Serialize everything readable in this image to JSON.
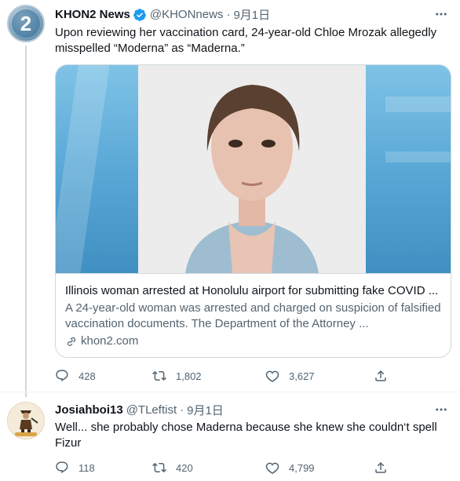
{
  "tweet1": {
    "author_name": "KHON2 News",
    "handle": "@KHONnews",
    "separator": "·",
    "date": "9月1日",
    "text": "Upon reviewing her vaccination card, 24-year-old Chloe Mrozak allegedly misspelled “Moderna” as “Maderna.”",
    "avatar_icon": "khon2-logo-icon",
    "card": {
      "title": "Illinois woman arrested at Honolulu airport for submitting fake COVID ...",
      "description": "A 24-year-old woman was arrested and charged on suspicion of falsified vaccination documents. The Department of the Attorney ...",
      "domain": "khon2.com"
    },
    "stats": {
      "replies": "428",
      "retweets": "1,802",
      "likes": "3,627"
    }
  },
  "tweet2": {
    "author_name": "Josiahboi13",
    "handle": "@TLeftist",
    "separator": "·",
    "date": "9月1日",
    "text": "Well... she probably chose Maderna because she knew she couldn‘t spell Fizur",
    "avatar_icon": "bot-hunter-avatar-icon",
    "stats": {
      "replies": "118",
      "retweets": "420",
      "likes": "4,799"
    }
  },
  "colors": {
    "text": "#0f1419",
    "secondary": "#536471",
    "verified": "#1d9bf0",
    "border": "#cfd9de"
  }
}
